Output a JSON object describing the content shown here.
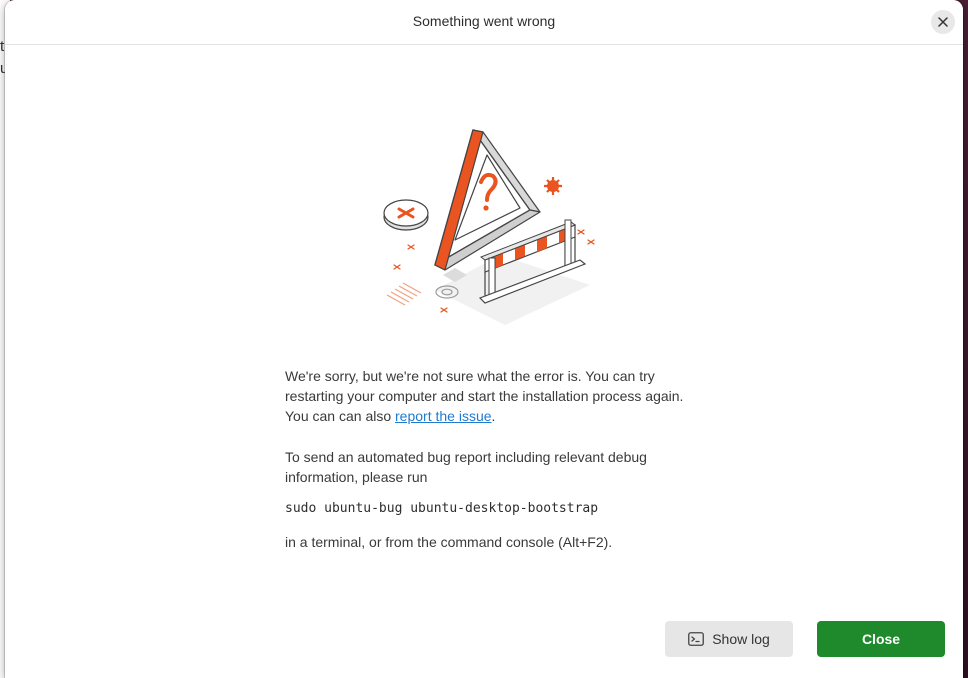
{
  "background_window": {
    "text_lines": [
      "t",
      "u"
    ]
  },
  "dialog": {
    "title": "Something went wrong",
    "close_icon": "close-icon",
    "illustration": "warning-triangle-with-barrier-illustration",
    "message": {
      "para1_text": "We're sorry, but we're not sure what the error is. You can try restarting your computer and start the installation process again. You can can also ",
      "para1_link": "report the issue",
      "para1_end": ".",
      "para2_text": "To send an automated bug report including relevant debug information, please run",
      "command": "sudo ubuntu-bug ubuntu-desktop-bootstrap",
      "para3_text": "in a terminal, or from the command console (Alt+F2)."
    },
    "buttons": {
      "show_log_label": "Show log",
      "show_log_icon": "terminal-icon",
      "close_label": "Close"
    }
  },
  "colors": {
    "accent": "#e95420",
    "primary_button": "#1e8a2b",
    "link": "#1f7bd1"
  }
}
